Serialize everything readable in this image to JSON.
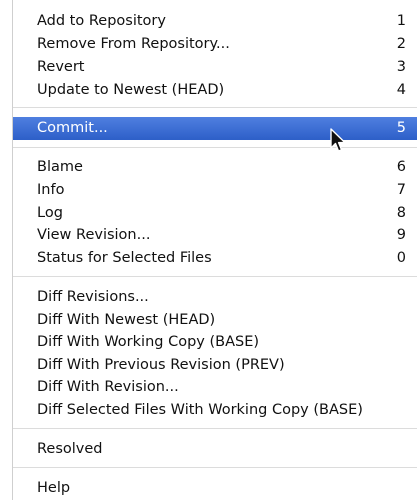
{
  "menu": {
    "groups": [
      {
        "items": [
          {
            "label": "Add to Repository",
            "shortcut": "1"
          },
          {
            "label": "Remove From Repository...",
            "shortcut": "2"
          },
          {
            "label": "Revert",
            "shortcut": "3"
          },
          {
            "label": "Update to Newest (HEAD)",
            "shortcut": "4"
          }
        ]
      },
      {
        "items": [
          {
            "label": "Commit...",
            "shortcut": "5",
            "selected": true
          }
        ]
      },
      {
        "items": [
          {
            "label": "Blame",
            "shortcut": "6"
          },
          {
            "label": "Info",
            "shortcut": "7"
          },
          {
            "label": "Log",
            "shortcut": "8"
          },
          {
            "label": "View Revision...",
            "shortcut": "9"
          },
          {
            "label": "Status for Selected Files",
            "shortcut": "0"
          }
        ]
      },
      {
        "items": [
          {
            "label": "Diff Revisions...",
            "shortcut": ""
          },
          {
            "label": "Diff With Newest (HEAD)",
            "shortcut": ""
          },
          {
            "label": "Diff With Working Copy (BASE)",
            "shortcut": ""
          },
          {
            "label": "Diff With Previous Revision (PREV)",
            "shortcut": ""
          },
          {
            "label": "Diff With Revision...",
            "shortcut": ""
          },
          {
            "label": "Diff Selected Files With Working Copy (BASE)",
            "shortcut": ""
          }
        ]
      },
      {
        "items": [
          {
            "label": "Resolved",
            "shortcut": ""
          }
        ]
      },
      {
        "items": [
          {
            "label": "Help",
            "shortcut": ""
          }
        ]
      }
    ],
    "colors": {
      "highlight": "#3c6dd2",
      "text": "#111111",
      "highlight_text": "#ffffff",
      "separator": "#dcdcdc"
    },
    "cursor_icon": "arrow-pointer-icon"
  }
}
